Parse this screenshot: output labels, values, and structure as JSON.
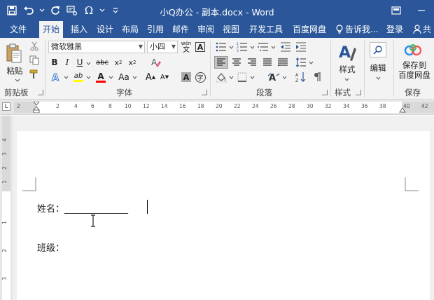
{
  "window": {
    "title": "小Q办公 - 副本.docx - Word",
    "accent": "#2b579a"
  },
  "qat": {
    "items": [
      "save-icon",
      "undo-icon",
      "redo-icon",
      "format-painter-icon",
      "symbol-omega-icon",
      "customize-icon"
    ]
  },
  "tabs": [
    "文件",
    "开始",
    "插入",
    "设计",
    "布局",
    "引用",
    "邮件",
    "审阅",
    "视图",
    "开发工具",
    "百度网盘"
  ],
  "active_tab": "开始",
  "tell_me": "告诉我...",
  "login": "登录",
  "share": "共",
  "ribbon": {
    "clipboard": {
      "paste": "粘贴",
      "label": "剪贴板"
    },
    "font": {
      "name": "微软雅黑",
      "size": "小四",
      "wen": "wén",
      "wen_char": "文",
      "label": "字体",
      "bold": "B",
      "italic": "I",
      "underline": "U",
      "strike": "abc",
      "subscript": "x",
      "sub_2": "2",
      "superscript": "x",
      "sup_2": "2",
      "grow": "A",
      "shrink": "A",
      "case": "Aa",
      "char_border": "A",
      "enclose": "字",
      "highlight_color": "#ffff00",
      "font_color": "#ff0000",
      "font_color_label": "A",
      "highlight_label": "ab"
    },
    "paragraph": {
      "label": "段落"
    },
    "styles": {
      "button": "样式",
      "label": "样式"
    },
    "editing": {
      "button": "编辑"
    },
    "save": {
      "button_line1": "保存到",
      "button_line2": "百度网盘",
      "label": "保存"
    }
  },
  "ruler": {
    "ticks": [
      "2",
      "2",
      "4",
      "6",
      "8",
      "10",
      "12",
      "14",
      "16",
      "18",
      "20",
      "22",
      "24",
      "26",
      "28",
      "30",
      "32",
      "34",
      "36",
      "38",
      "40",
      "42"
    ],
    "corner": "L"
  },
  "vruler": {
    "ticks": [
      "4",
      "3",
      "2",
      "1",
      "1",
      "2",
      "3"
    ]
  },
  "document": {
    "line1_label": "姓名：",
    "line1_blank": "______________",
    "line2_label": "班级："
  }
}
